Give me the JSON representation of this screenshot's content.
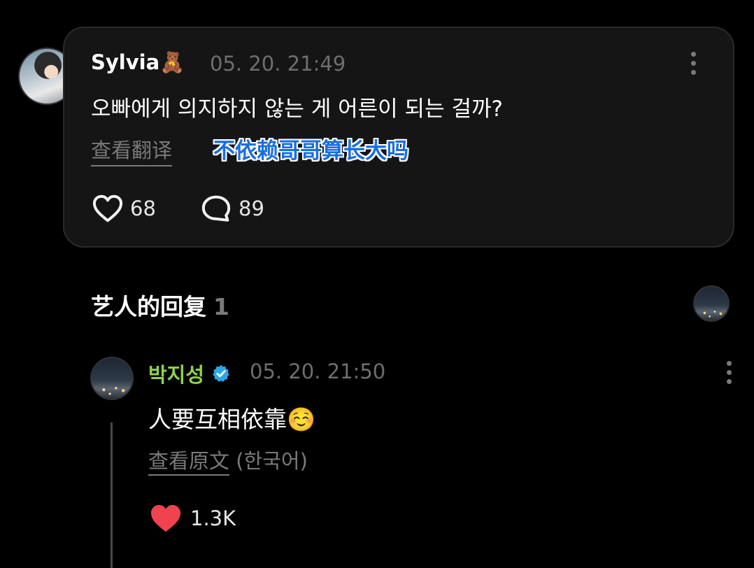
{
  "post": {
    "author": "Sylvia🧸",
    "timestamp": "05. 20. 21:49",
    "text": "오빠에게 의지하지 않는 게 어른이 되는 걸까?",
    "translate_label": "查看翻译",
    "overlay_translation": "不依赖哥哥算长大吗",
    "like_count": "68",
    "comment_count": "89"
  },
  "replies_section": {
    "title": "艺人的回复",
    "count": "1"
  },
  "reply": {
    "author": "박지성",
    "timestamp": "05. 20. 21:50",
    "text": "人要互相依靠☺️",
    "original_label": "查看原文",
    "original_language": "(한국어)",
    "like_count": "1.3K"
  },
  "colors": {
    "background": "#000000",
    "card": "#151515",
    "artist_name": "#8fd14f",
    "verified_badge": "#2aa7e6",
    "liked_heart": "#f0424f",
    "overlay_text": "#1a6fe0"
  },
  "icons": {
    "author_emoji": "teddy-bear",
    "like": "heart-outline-icon",
    "comment": "speech-bubble-icon",
    "verified": "verified-badge-icon",
    "liked": "heart-filled-icon",
    "menu": "more-vertical-icon"
  }
}
